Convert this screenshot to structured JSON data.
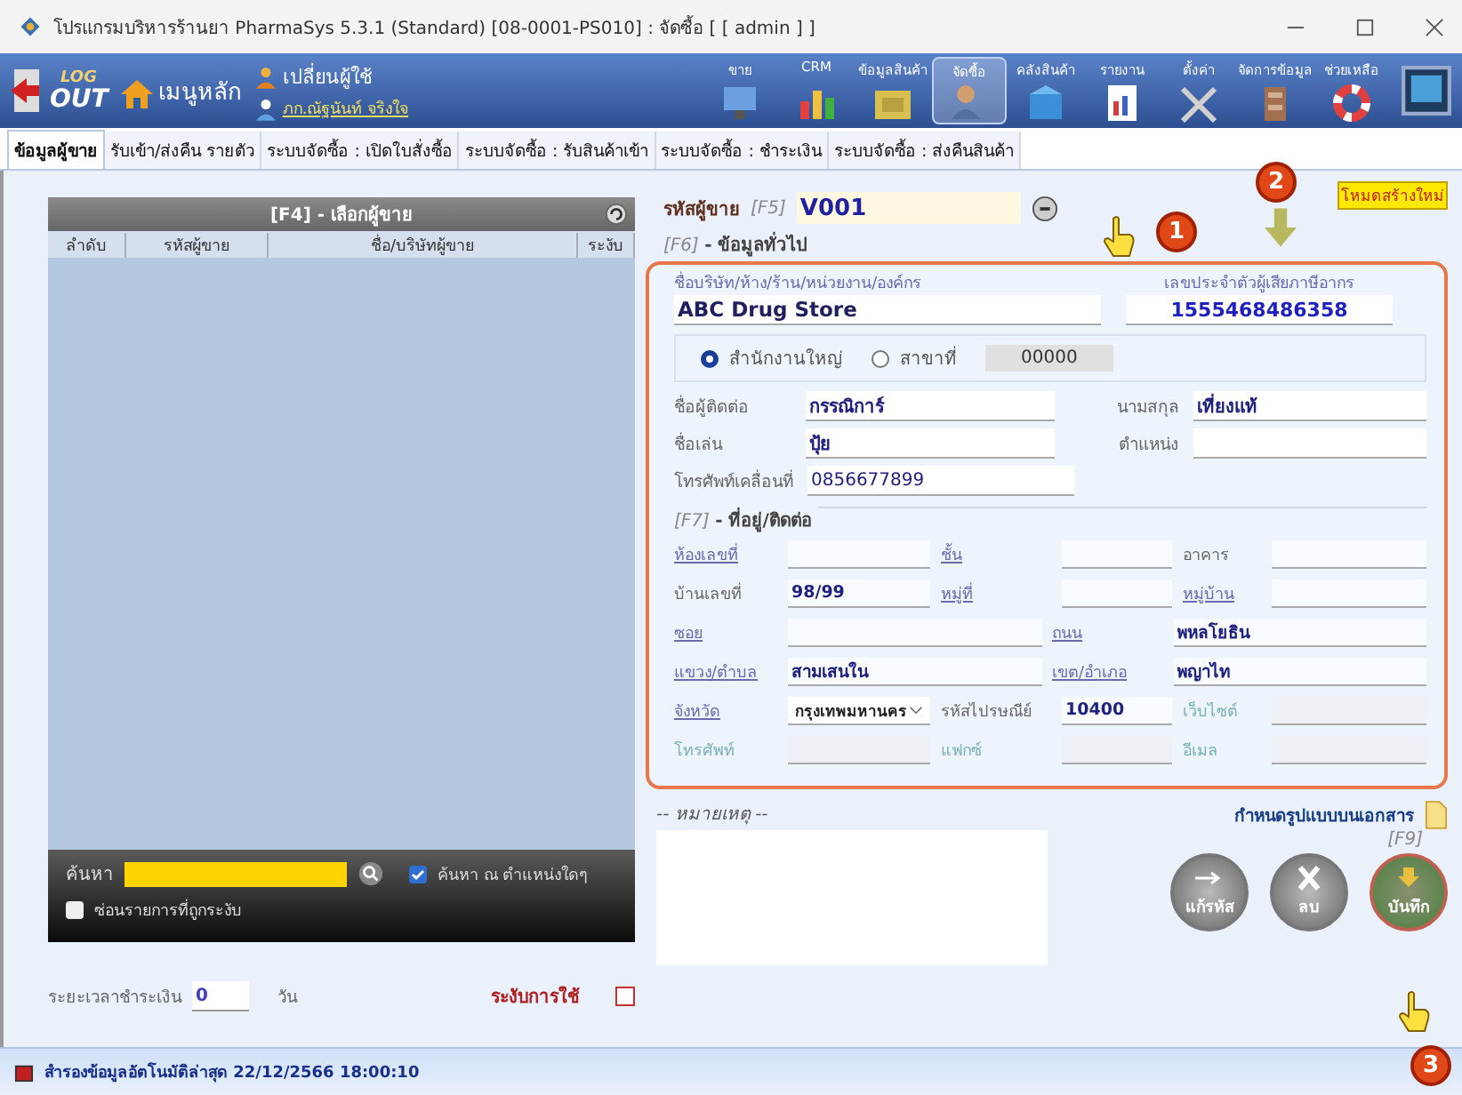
{
  "window": {
    "title": "โปรแกรมบริหารร้านยา PharmaSys 5.3.1 (Standard) [08-0001-PS010] : จัดซื้อ  [ [ admin ] ]"
  },
  "toolbar": {
    "logout_top": "LOG",
    "logout_bottom": "OUT",
    "home": "เมนูหลัก",
    "switch_user": "เปลี่ยนผู้ใช้",
    "user_name": "ภก.ณัฐนันท์ จริงใจ",
    "modules": [
      {
        "label": "ขาย",
        "kind": "sale",
        "selected": false
      },
      {
        "label": "CRM",
        "kind": "crm",
        "selected": false
      },
      {
        "label": "ข้อมูลสินค้า",
        "kind": "product",
        "selected": false
      },
      {
        "label": "จัดซื้อ",
        "kind": "purchase",
        "selected": true
      },
      {
        "label": "คลังสินค้า",
        "kind": "stock",
        "selected": false
      },
      {
        "label": "รายงาน",
        "kind": "report",
        "selected": false
      },
      {
        "label": "ตั้งค่า",
        "kind": "settings",
        "selected": false
      },
      {
        "label": "จัดการข้อมูล",
        "kind": "data",
        "selected": false
      },
      {
        "label": "ช่วยเหลือ",
        "kind": "help",
        "selected": false
      }
    ]
  },
  "tabs": [
    {
      "label": "ข้อมูลผู้ขาย",
      "selected": true
    },
    {
      "label": "รับเข้า/ส่งคืน รายตัว",
      "selected": false
    },
    {
      "label": "ระบบจัดซื้อ : เปิดใบสั่งซื้อ",
      "selected": false
    },
    {
      "label": "ระบบจัดซื้อ : รับสินค้าเข้า",
      "selected": false
    },
    {
      "label": "ระบบจัดซื้อ : ชำระเงิน",
      "selected": false
    },
    {
      "label": "ระบบจัดซื้อ : ส่งคืนสินค้า",
      "selected": false
    }
  ],
  "vendor_list": {
    "title": "[F4] - เลือกผู้ขาย",
    "columns": [
      "ลำดับ",
      "รหัสผู้ขาย",
      "ชื่อ/บริษัทผู้ขาย",
      "ระงับ"
    ],
    "search_label": "ค้นหา",
    "search_anywhere": {
      "label": "ค้นหา ณ ตำแหน่งใดๆ",
      "checked": true
    },
    "hide_suspended": {
      "label": "ซ่อนรายการที่ถูกระงับ",
      "checked": false
    }
  },
  "payment_term": {
    "label": "ระยะเวลาชำระเงิน",
    "value": "0",
    "unit": "วัน"
  },
  "suspend": {
    "label": "ระงับการใช้",
    "checked": false
  },
  "vendor_code": {
    "label": "รหัสผู้ขาย",
    "key": "[F5]",
    "value": "V001"
  },
  "mode_badge": "โหมดสร้างใหม่",
  "general": {
    "key": "[F6]",
    "title": "- ข้อมูลทั่วไป",
    "company_label": "ชื่อบริษัท/ห้าง/ร้าน/หน่วยงาน/องค์กร",
    "company": "ABC Drug Store",
    "tax_label": "เลขประจำตัวผู้เสียภาษีอากร",
    "tax_id": "1555468486358",
    "branch_options": [
      {
        "label": "สำนักงานใหญ่",
        "selected": true
      },
      {
        "label": "สาขาที่",
        "selected": false
      }
    ],
    "branch_no": "00000",
    "contact_rows": [
      [
        {
          "label": "ชื่อผู้ติดต่อ",
          "value": "กรรณิการ์"
        },
        {
          "label": "นามสกุล",
          "value": "เที่ยงแท้"
        }
      ],
      [
        {
          "label": "ชื่อเล่น",
          "value": "ปุ้ย"
        },
        {
          "label": "ตำแหน่ง"
        }
      ]
    ],
    "mobile": {
      "label": "โทรศัพท์เคลื่อนที่",
      "value": "0856677899"
    }
  },
  "address": {
    "key": "[F7]",
    "title": "- ที่อยู่/ติดต่อ",
    "rows": [
      [
        {
          "label": "ห้องเลขที่",
          "link": true,
          "disabled": false
        },
        {
          "label": "ชั้น",
          "link": true,
          "disabled": false
        },
        {
          "label": "อาคาร",
          "link": false,
          "disabled": false
        }
      ],
      [
        {
          "label": "บ้านเลขที่",
          "value": "98/99",
          "link": false,
          "disabled": false
        },
        {
          "label": "หมู่ที่",
          "link": true,
          "disabled": false
        },
        {
          "label": "หมู่บ้าน",
          "link": true,
          "disabled": false
        }
      ],
      [
        {
          "label": "ซอย",
          "link": true,
          "disabled": false
        },
        {
          "label": "ถนน",
          "value": "พหลโยธิน",
          "link": true,
          "disabled": false
        }
      ],
      [
        {
          "label": "แขวง/ตำบล",
          "value": "สามเสนใน",
          "link": true,
          "disabled": false
        },
        {
          "label": "เขต/อำเภอ",
          "value": "พญาไท",
          "link": true,
          "disabled": false
        }
      ],
      [
        {
          "label": "จังหวัด",
          "value": "กรุงเทพมหานคร",
          "kind": "select",
          "link": true,
          "disabled": false
        },
        {
          "label": "รหัสไปรษณีย์",
          "value": "10400",
          "link": false,
          "disabled": false
        },
        {
          "label": "เว็บไซต์",
          "link": false,
          "disabled": true
        }
      ],
      [
        {
          "label": "โทรศัพท์",
          "link": false,
          "disabled": true
        },
        {
          "label": "แฟกซ์",
          "link": false,
          "disabled": true
        },
        {
          "label": "อีเมล",
          "link": false,
          "disabled": true
        }
      ]
    ]
  },
  "notes_label": "-- หมายเหตุ --",
  "doc_format": "กำหนดรูปแบบบนเอกสาร",
  "save_key": "[F9]",
  "actions": [
    {
      "label": "แก้รหัส",
      "kind": "rename"
    },
    {
      "label": "ลบ",
      "kind": "delete"
    },
    {
      "label": "บันทึก",
      "kind": "save"
    }
  ],
  "status": "สำรองข้อมูลอัตโนมัติล่าสุด  22/12/2566 18:00:10",
  "callouts": [
    "1",
    "2",
    "3"
  ]
}
